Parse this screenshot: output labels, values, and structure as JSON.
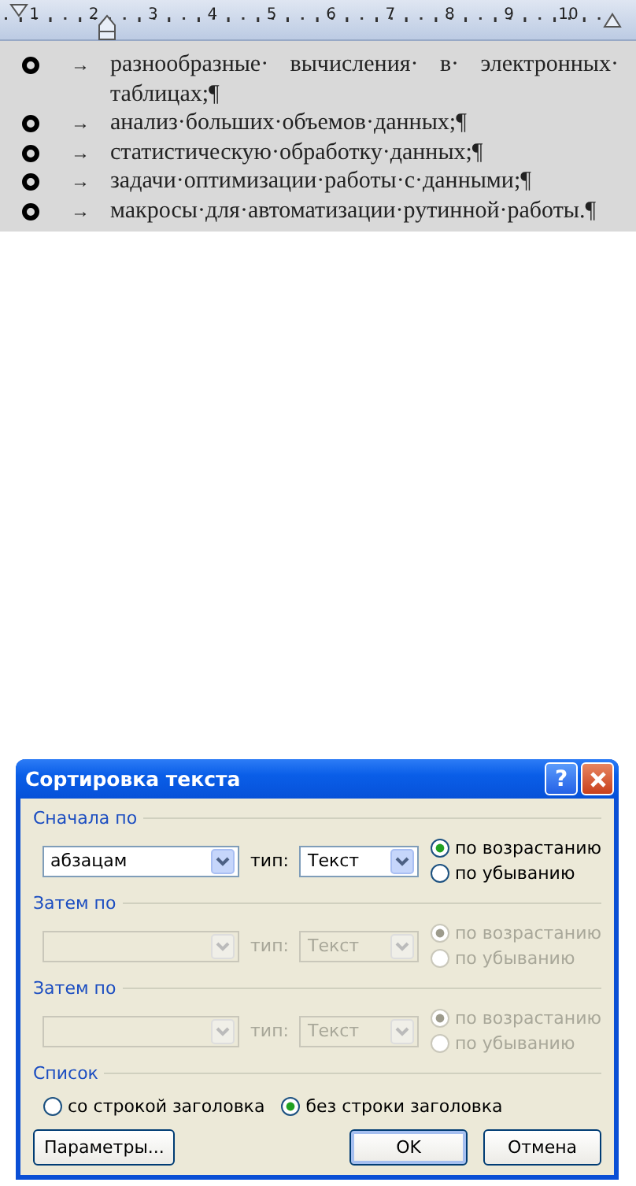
{
  "ruler": {
    "labels": [
      "1",
      "2",
      "3",
      "4",
      "5",
      "6",
      "7",
      "8",
      "9",
      "10"
    ]
  },
  "list": {
    "items": [
      {
        "arrow": "→",
        "text": "разнообразные· вычисления· в· электронных· таблицах;¶"
      },
      {
        "arrow": "→",
        "text": "анализ·больших·объемов·данных;¶"
      },
      {
        "arrow": "→",
        "text": "статистическую·обработку·данных;¶"
      },
      {
        "arrow": "→",
        "text": "задачи·оптимизации·работы·с·данными;¶"
      },
      {
        "arrow": "→",
        "text": "макросы·для·автоматизации·рутинной·работы.¶"
      }
    ]
  },
  "dialog": {
    "title": "Сортировка текста",
    "help": "?",
    "sections": [
      {
        "legend": "Сначала по",
        "disabled": false,
        "field": "абзацам",
        "type_label": "тип:",
        "type_value": "Текст",
        "order": [
          {
            "label": "по возрастанию",
            "selected": true
          },
          {
            "label": "по убыванию",
            "selected": false
          }
        ]
      },
      {
        "legend": "Затем по",
        "disabled": true,
        "type_label": "тип:",
        "type_value": "Текст",
        "order": [
          {
            "label": "по возрастанию",
            "selected": true
          },
          {
            "label": "по убыванию",
            "selected": false
          }
        ]
      },
      {
        "legend": "Затем по",
        "disabled": true,
        "type_label": "тип:",
        "type_value": "Текст",
        "order": [
          {
            "label": "по возрастанию",
            "selected": true
          },
          {
            "label": "по убыванию",
            "selected": false
          }
        ]
      }
    ],
    "list_section": {
      "legend": "Список",
      "options": [
        {
          "label": "со строкой заголовка",
          "selected": false
        },
        {
          "label": "без строки заголовка",
          "selected": true
        }
      ]
    },
    "buttons": [
      {
        "label": "Параметры...",
        "default": false,
        "kind": "left"
      },
      {
        "label": "OK",
        "default": true,
        "kind": "right"
      },
      {
        "label": "Отмена",
        "default": false,
        "kind": "right"
      }
    ]
  }
}
